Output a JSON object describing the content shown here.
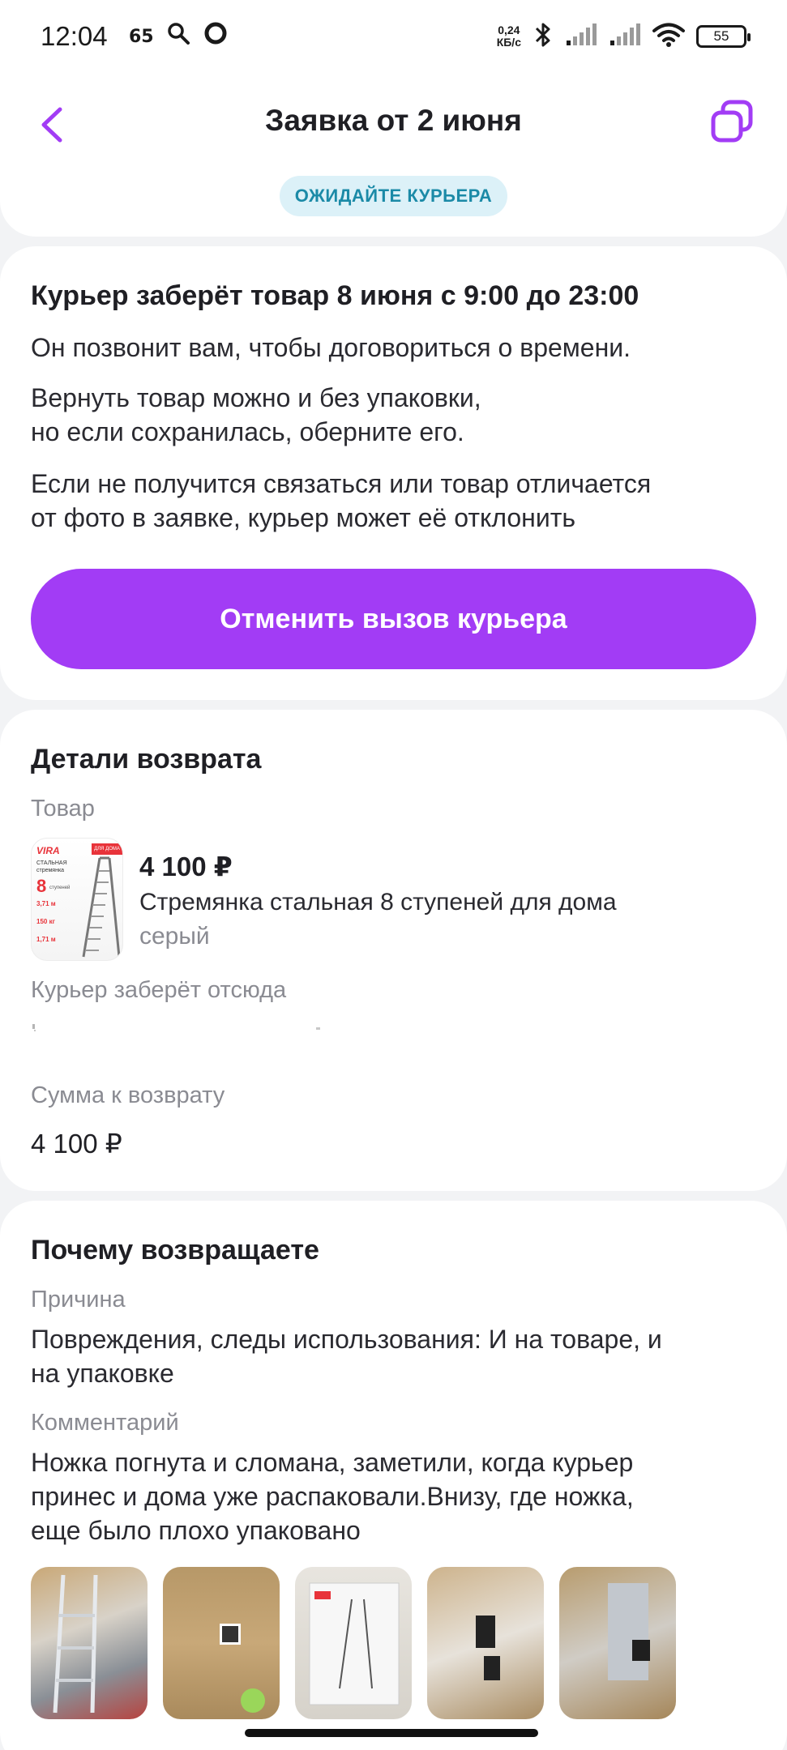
{
  "status_bar": {
    "time": "12:04",
    "net_speed_value": "0,24",
    "net_speed_unit": "КБ/с",
    "battery": "55"
  },
  "header": {
    "title": "Заявка от 2 июня",
    "status_badge": "ОЖИДАЙТЕ КУРЬЕРА"
  },
  "courier": {
    "title": "Курьер заберёт товар 8 июня с 9:00 до 23:00",
    "line1": "Он позвонит вам, чтобы договориться о времени.",
    "line2a": "Вернуть товар можно и без упаковки,",
    "line2b": "но если сохранилась, оберните его.",
    "line3a": "Если не получится связаться или товар отличается",
    "line3b": "от фото в заявке, курьер может её отклонить",
    "cancel_label": "Отменить вызов курьера"
  },
  "details": {
    "title": "Детали возврата",
    "product_label": "Товар",
    "price": "4 100 ₽",
    "product_name": "Стремянка стальная 8 ступеней для дома",
    "product_color": "серый",
    "pickup_label": "Курьер заберёт отсюда",
    "refund_label": "Сумма к возврату",
    "refund_value": "4 100 ₽",
    "thumb_brand": "VIRA",
    "thumb_tag": "ДЛЯ ДОМА",
    "thumb_desc": "СТАЛЬНАЯ стремянка",
    "thumb_steps": "8",
    "thumb_steps_label": "ступеней",
    "thumb_spec1": "3,71 м",
    "thumb_spec2": "150 кг",
    "thumb_spec3": "1,71 м"
  },
  "reason": {
    "title": "Почему возвращаете",
    "reason_label": "Причина",
    "reason_text_a": "Повреждения, следы использования: И на товаре, и",
    "reason_text_b": "на упаковке",
    "comment_label": "Комментарий",
    "comment_a": "Ножка погнута и сломана, заметили, когда курьер",
    "comment_b": "принес и дома уже распаковали.Внизу, где ножка,",
    "comment_c": "еще было плохо упаковано"
  },
  "colors": {
    "accent": "#a23cf5",
    "badge_bg": "#dcf1f8",
    "badge_text": "#1b8aa7",
    "muted_text": "#8a8b92"
  }
}
